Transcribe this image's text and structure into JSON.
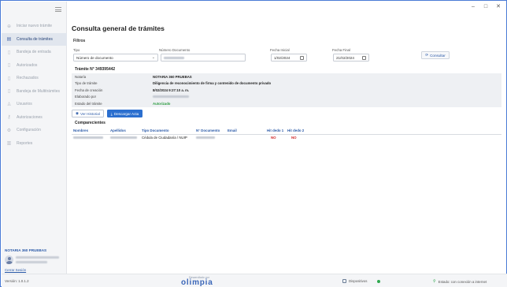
{
  "window_controls": {
    "minimize": "–",
    "maximize": "□",
    "close": "✕"
  },
  "sidebar": {
    "items": [
      {
        "label": "Iniciar nuevo trámite",
        "icon": "plus-circle-icon",
        "active": false
      },
      {
        "label": "Consulta de trámites",
        "icon": "list-icon",
        "active": true
      },
      {
        "label": "Bandeja de entrada",
        "icon": "document-icon",
        "active": false
      },
      {
        "label": "Autorizados",
        "icon": "document-icon",
        "active": false
      },
      {
        "label": "Rechazados",
        "icon": "document-icon",
        "active": false
      },
      {
        "label": "Bandeja de Multitrámites",
        "icon": "document-icon",
        "active": false
      },
      {
        "label": "Usuarios",
        "icon": "user-icon",
        "active": false
      },
      {
        "label": "Autorizaciones",
        "icon": "key-icon",
        "active": false
      },
      {
        "label": "Configuración",
        "icon": "gear-icon",
        "active": false
      },
      {
        "label": "Reportes",
        "icon": "chart-icon",
        "active": false
      }
    ],
    "user": {
      "notaria": "NOTARIA 360 PRUEBAS",
      "logout": "Cerrar Sesión"
    }
  },
  "main": {
    "title": "Consulta general de trámites",
    "filters": {
      "title": "Filtros",
      "tipo_label": "Tipo",
      "tipo_value": "Número de documento",
      "numdoc_label": "Número Documento",
      "fecha_inicial_label": "Fecha Inicial",
      "fecha_inicial_value": "1/02/2024",
      "fecha_final_label": "Fecha Final",
      "fecha_final_value": "21/02/2024",
      "consult_button": "Consultar"
    },
    "tramite": {
      "title": "Trámite N° 349395442",
      "rows": [
        {
          "key": "Notaría",
          "value": "NOTARIA 360 PRUEBAS"
        },
        {
          "key": "Tipo de trámite",
          "value": "Diligencia de reconocimiento de firma y contenido de documento privado"
        },
        {
          "key": "Fecha de creación",
          "value": "8/02/2024 9:27:10 a. m."
        },
        {
          "key": "Elaborado por",
          "value": ""
        },
        {
          "key": "Estado del trámite",
          "value": "Autorizado"
        }
      ],
      "history_button": "Ver Historial",
      "download_button": "Descargar Acta"
    },
    "comparecientes": {
      "title": "Comparecientes",
      "headers": [
        "Nombres",
        "Apellidos",
        "Tipo Documento",
        "N° Documento",
        "Email",
        "Hit dedo 1",
        "Hit dedo 2"
      ],
      "rows": [
        {
          "nombres": "",
          "apellidos": "",
          "tipo": "Cédula de Ciudadanía / NUIP",
          "numero": "",
          "email": "",
          "hit1": "NO",
          "hit2": "NO"
        }
      ]
    }
  },
  "footer": {
    "version": "Versión: 1.0.1.2",
    "developed_by": "Desarrollado por",
    "brand": "olimpia",
    "devices": "Dispositivos",
    "connection": "Estado: con conexión a internet"
  },
  "colors": {
    "accent": "#2b6fcf",
    "status_ok": "#2a9b3f",
    "status_no": "#d02626"
  }
}
